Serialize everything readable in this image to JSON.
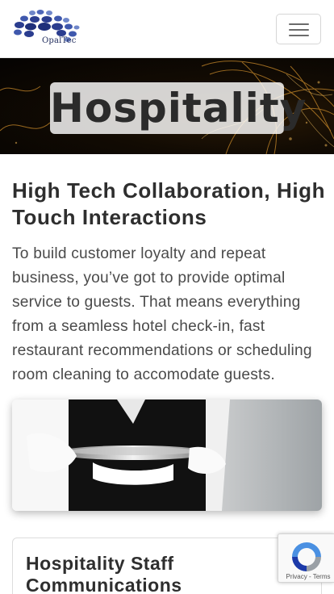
{
  "brand": {
    "name": "OpalTec",
    "logo_color": "#2b3d8f"
  },
  "navbar": {
    "toggler_icon": "hamburger-menu-icon"
  },
  "hero": {
    "title": "Hospitality"
  },
  "main": {
    "heading": "High Tech Collaboration, High Touch Interactions",
    "paragraph": "To build customer loyalty and repeat business, you’ve got to provide optimal service to guests. That means everything from a seamless hotel check-in, fast restaurant recommendations or scheduling room cleaning to accomodate guests."
  },
  "card": {
    "title": "Hospitality Staff Communications"
  },
  "recaptcha": {
    "links": "Privacy - Terms"
  },
  "colors": {
    "hero_background": "#0b0703",
    "hero_swirl": "#c98a2a",
    "text_dark": "#2e2e2e",
    "border": "#dcdcdc"
  }
}
